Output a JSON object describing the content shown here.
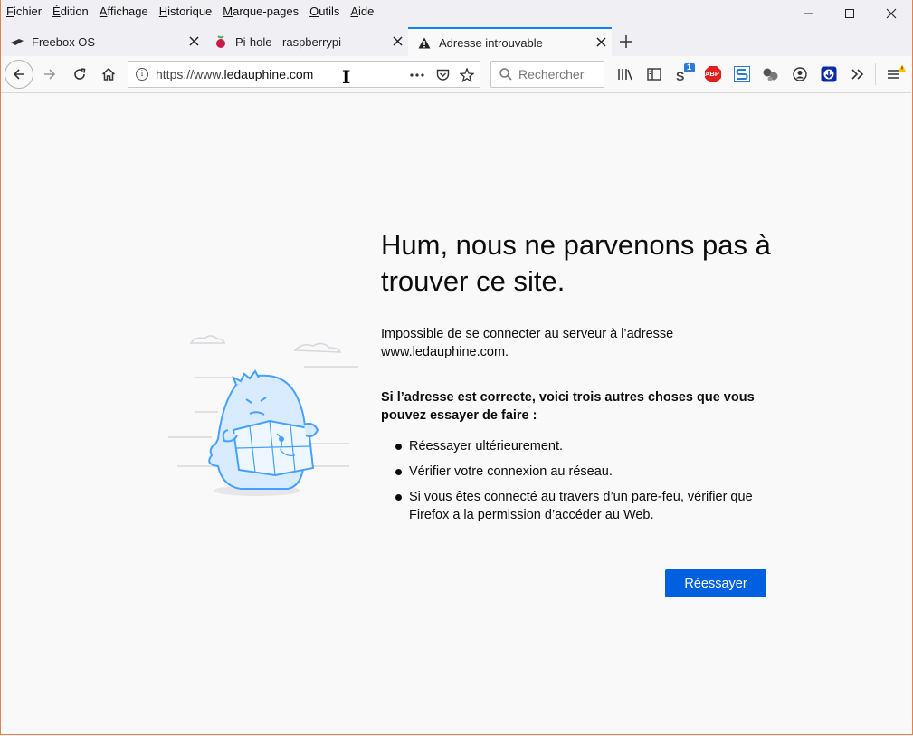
{
  "menu": [
    {
      "label": "Fichier",
      "key": "F",
      "rest": "ichier"
    },
    {
      "label": "Édition",
      "key": "É",
      "rest": "dition"
    },
    {
      "label": "Affichage",
      "key": "A",
      "rest": "ffichage"
    },
    {
      "label": "Historique",
      "key": "H",
      "rest": "istorique"
    },
    {
      "label": "Marque-pages",
      "key": "M",
      "rest": "arque-pages"
    },
    {
      "label": "Outils",
      "key": "O",
      "rest": "utils"
    },
    {
      "label": "Aide",
      "key": "A",
      "rest": "ide"
    }
  ],
  "tabs": [
    {
      "title": "Freebox OS",
      "icon": "freebox-icon",
      "active": false
    },
    {
      "title": "Pi-hole - raspberrypi",
      "icon": "raspberry-icon",
      "active": false
    },
    {
      "title": "Adresse introuvable",
      "icon": "warning-icon",
      "active": true
    }
  ],
  "navbar": {
    "url_prefix": "https://www.",
    "url_domain": "ledauphine.com",
    "search_placeholder": "Rechercher",
    "sync_badge": "1",
    "abp_label": "ABP"
  },
  "error": {
    "title": "Hum, nous ne parvenons pas à trouver ce site.",
    "description": "Impossible de se connecter au serveur à l’adresse www.ledauphine.com.",
    "hint": "Si l’adresse est correcte, voici trois autres choses que vous pouvez essayer de faire :",
    "suggestions": [
      "Réessayer ultérieurement.",
      "Vérifier votre connexion au réseau.",
      "Si vous êtes connecté au travers d’un pare-feu, vérifier que Firefox a la permission d’accéder au Web."
    ],
    "retry_label": "Réessayer"
  },
  "colors": {
    "accent": "#0a84ff",
    "button": "#0060df",
    "illustration": "#45a1ff"
  }
}
